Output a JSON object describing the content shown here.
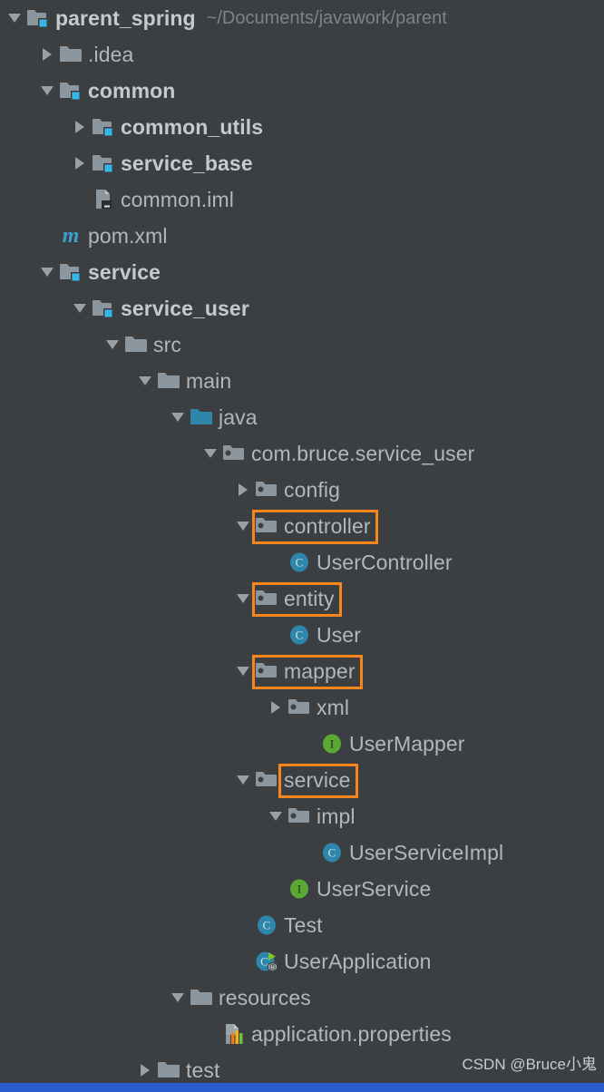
{
  "window": {
    "background_color": "#3c3f41",
    "accent_highlight_color": "#f7861c",
    "text_color": "#b4b7ba",
    "bottom_bar_color": "#2b5dd1"
  },
  "watermark": {
    "text": "CSDN @Bruce小鬼"
  },
  "project_tree": {
    "nodes": [
      {
        "label": "parent_spring",
        "suffix": "~/Documents/javawork/parent",
        "icon": "module-folder-icon",
        "depth": 0,
        "state": "expanded",
        "bold": true,
        "highlighted": false
      },
      {
        "label": ".idea",
        "suffix": "",
        "icon": "folder-icon",
        "depth": 1,
        "state": "collapsed",
        "bold": false,
        "highlighted": false
      },
      {
        "label": "common",
        "suffix": "",
        "icon": "module-folder-icon",
        "depth": 1,
        "state": "expanded",
        "bold": true,
        "highlighted": false
      },
      {
        "label": "common_utils",
        "suffix": "",
        "icon": "module-folder-icon",
        "depth": 2,
        "state": "collapsed",
        "bold": true,
        "highlighted": false
      },
      {
        "label": "service_base",
        "suffix": "",
        "icon": "module-folder-icon",
        "depth": 2,
        "state": "collapsed",
        "bold": true,
        "highlighted": false
      },
      {
        "label": "common.iml",
        "suffix": "",
        "icon": "iml-file-icon",
        "depth": 2,
        "state": "leaf",
        "bold": false,
        "highlighted": false
      },
      {
        "label": "pom.xml",
        "suffix": "",
        "icon": "maven-pom-icon",
        "depth": 1,
        "state": "leaf",
        "bold": false,
        "highlighted": false
      },
      {
        "label": "service",
        "suffix": "",
        "icon": "module-folder-icon",
        "depth": 1,
        "state": "expanded",
        "bold": true,
        "highlighted": false
      },
      {
        "label": "service_user",
        "suffix": "",
        "icon": "module-folder-icon",
        "depth": 2,
        "state": "expanded",
        "bold": true,
        "highlighted": false
      },
      {
        "label": "src",
        "suffix": "",
        "icon": "folder-icon",
        "depth": 3,
        "state": "expanded",
        "bold": false,
        "highlighted": false
      },
      {
        "label": "main",
        "suffix": "",
        "icon": "folder-icon",
        "depth": 4,
        "state": "expanded",
        "bold": false,
        "highlighted": false
      },
      {
        "label": "java",
        "suffix": "",
        "icon": "source-root-folder-icon",
        "depth": 5,
        "state": "expanded",
        "bold": false,
        "highlighted": false
      },
      {
        "label": "com.bruce.service_user",
        "suffix": "",
        "icon": "package-icon",
        "depth": 6,
        "state": "expanded",
        "bold": false,
        "highlighted": false
      },
      {
        "label": "config",
        "suffix": "",
        "icon": "package-icon",
        "depth": 7,
        "state": "collapsed",
        "bold": false,
        "highlighted": false
      },
      {
        "label": "controller",
        "suffix": "",
        "icon": "package-icon",
        "depth": 7,
        "state": "expanded",
        "bold": false,
        "highlighted": true,
        "highlight_style": "icon-and-text"
      },
      {
        "label": "UserController",
        "suffix": "",
        "icon": "java-class-icon",
        "depth": 8,
        "state": "leaf",
        "bold": false,
        "highlighted": false
      },
      {
        "label": "entity",
        "suffix": "",
        "icon": "package-icon",
        "depth": 7,
        "state": "expanded",
        "bold": false,
        "highlighted": true,
        "highlight_style": "icon-and-text"
      },
      {
        "label": "User",
        "suffix": "",
        "icon": "java-class-icon",
        "depth": 8,
        "state": "leaf",
        "bold": false,
        "highlighted": false
      },
      {
        "label": "mapper",
        "suffix": "",
        "icon": "package-icon",
        "depth": 7,
        "state": "expanded",
        "bold": false,
        "highlighted": true,
        "highlight_style": "icon-and-text"
      },
      {
        "label": "xml",
        "suffix": "",
        "icon": "package-icon",
        "depth": 8,
        "state": "collapsed",
        "bold": false,
        "highlighted": false
      },
      {
        "label": "UserMapper",
        "suffix": "",
        "icon": "java-interface-icon",
        "depth": 9,
        "state": "leaf",
        "bold": false,
        "highlighted": false
      },
      {
        "label": "service",
        "suffix": "",
        "icon": "package-icon",
        "depth": 7,
        "state": "expanded",
        "bold": false,
        "highlighted": true,
        "highlight_style": "text-only"
      },
      {
        "label": "impl",
        "suffix": "",
        "icon": "package-icon",
        "depth": 8,
        "state": "expanded",
        "bold": false,
        "highlighted": false
      },
      {
        "label": "UserServiceImpl",
        "suffix": "",
        "icon": "java-class-icon",
        "depth": 9,
        "state": "leaf",
        "bold": false,
        "highlighted": false
      },
      {
        "label": "UserService",
        "suffix": "",
        "icon": "java-interface-icon",
        "depth": 8,
        "state": "leaf",
        "bold": false,
        "highlighted": false
      },
      {
        "label": "Test",
        "suffix": "",
        "icon": "java-class-icon",
        "depth": 7,
        "state": "leaf",
        "bold": false,
        "highlighted": false
      },
      {
        "label": "UserApplication",
        "suffix": "",
        "icon": "spring-boot-app-icon",
        "depth": 7,
        "state": "leaf",
        "bold": false,
        "highlighted": false
      },
      {
        "label": "resources",
        "suffix": "",
        "icon": "folder-icon",
        "depth": 5,
        "state": "expanded",
        "bold": false,
        "highlighted": false
      },
      {
        "label": "application.properties",
        "suffix": "",
        "icon": "properties-file-icon",
        "depth": 6,
        "state": "leaf",
        "bold": false,
        "highlighted": false
      },
      {
        "label": "test",
        "suffix": "",
        "icon": "folder-icon",
        "depth": 4,
        "state": "collapsed",
        "bold": false,
        "highlighted": false
      }
    ]
  }
}
